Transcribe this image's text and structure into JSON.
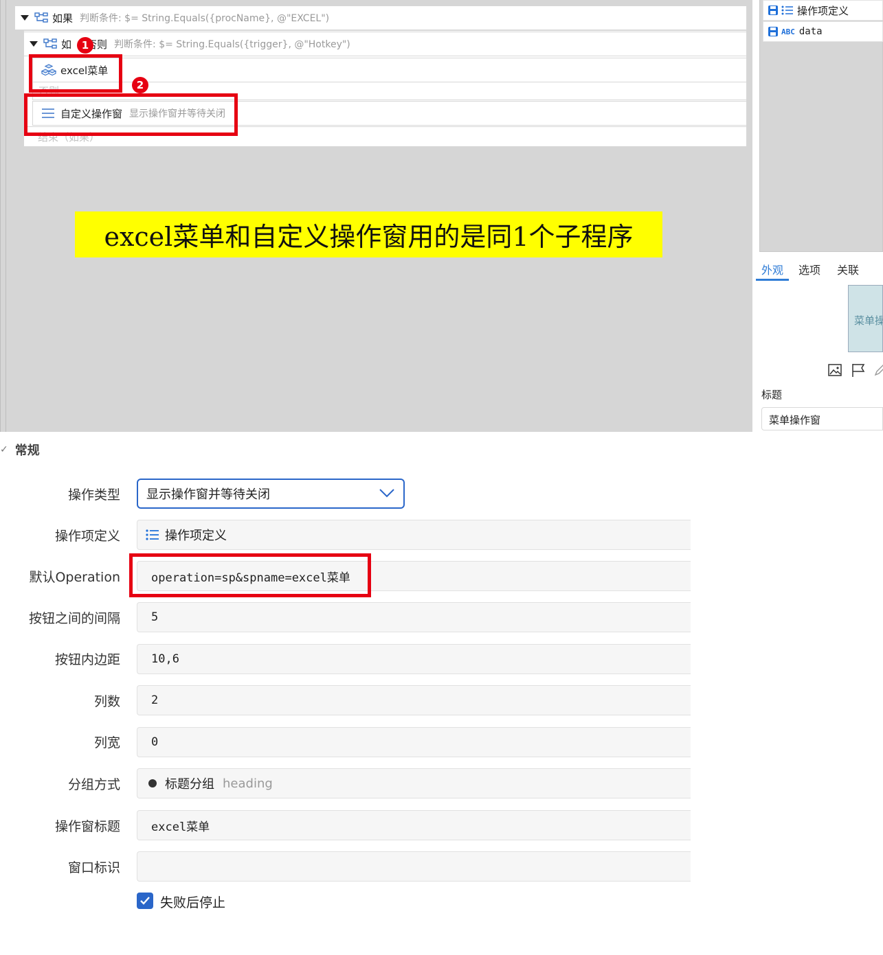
{
  "flow": {
    "if_row": {
      "label": "如果",
      "cond": "判断条件:  $= String.Equals({procName}, @\"EXCEL\")"
    },
    "elseif_row": {
      "label_left": "如",
      "label_right": "否则",
      "cond": "判断条件:  $= String.Equals({trigger}, @\"Hotkey\")"
    },
    "excel_row": {
      "label": "excel菜单"
    },
    "faded_row_text": "否则",
    "custom_row": {
      "label": "自定义操作窗",
      "desc": "显示操作窗并等待关闭"
    },
    "end_row_text": "结束（如果）",
    "badges": [
      "1",
      "2"
    ],
    "banner": "excel菜单和自定义操作窗用的是同1个子程序"
  },
  "side": {
    "items": [
      {
        "icon": "list-icon",
        "label": "操作项定义"
      },
      {
        "icon": "abc-icon",
        "label": "ABC",
        "value": "data"
      }
    ],
    "tabs": [
      "外观",
      "选项",
      "关联"
    ],
    "active_tab": "外观",
    "thumb_text": "菜单操",
    "title_label": "标题",
    "title_value": "菜单操作窗"
  },
  "form": {
    "section": "常规",
    "fields": {
      "op_type": {
        "label": "操作类型",
        "value": "显示操作窗并等待关闭"
      },
      "item_def": {
        "label": "操作项定义",
        "value": "操作项定义"
      },
      "default_op": {
        "label": "默认Operation",
        "value": "operation=sp&spname=excel菜单"
      },
      "btn_gap": {
        "label": "按钮之间的间隔",
        "value": "5"
      },
      "btn_padding": {
        "label": "按钮内边距",
        "value": "10,6"
      },
      "columns": {
        "label": "列数",
        "value": "2"
      },
      "col_width": {
        "label": "列宽",
        "value": "0"
      },
      "grouping": {
        "label": "分组方式",
        "value": "标题分组",
        "hint": "heading"
      },
      "window_title": {
        "label": "操作窗标题",
        "value": "excel菜单"
      },
      "window_id": {
        "label": "窗口标识",
        "value": ""
      }
    },
    "stop_on_fail": {
      "label": "失败后停止",
      "checked": true
    }
  },
  "colors": {
    "highlight": "#e60012",
    "banner": "#ffff00",
    "accent": "#2a66c9",
    "tab_active": "#2f7cd6"
  }
}
